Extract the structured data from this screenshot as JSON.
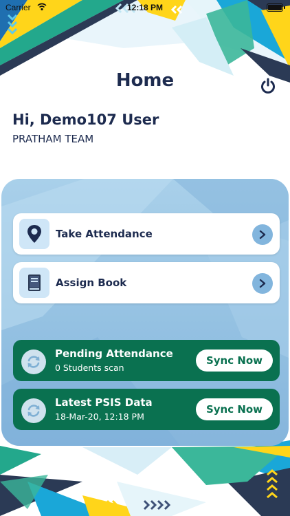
{
  "status_bar": {
    "carrier": "Carrier",
    "time": "12:18 PM"
  },
  "header": {
    "title": "Home"
  },
  "user": {
    "greeting": "Hi, Demo107 User",
    "team": "PRATHAM TEAM"
  },
  "menu": [
    {
      "label": "Take Attendance",
      "icon": "location-pin-icon"
    },
    {
      "label": "Assign Book",
      "icon": "book-icon"
    }
  ],
  "sync": [
    {
      "title": "Pending Attendance",
      "subtitle": "0 Students scan",
      "button": "Sync Now"
    },
    {
      "title": "Latest PSIS Data",
      "subtitle": "18-Mar-20, 12:18 PM",
      "button": "Sync Now"
    }
  ],
  "colors": {
    "title": "#1d2b4f",
    "sync_card": "#0a7150",
    "panel": "#94c1e2",
    "accent_yellow": "#ffd51a",
    "accent_teal": "#23a88c"
  }
}
